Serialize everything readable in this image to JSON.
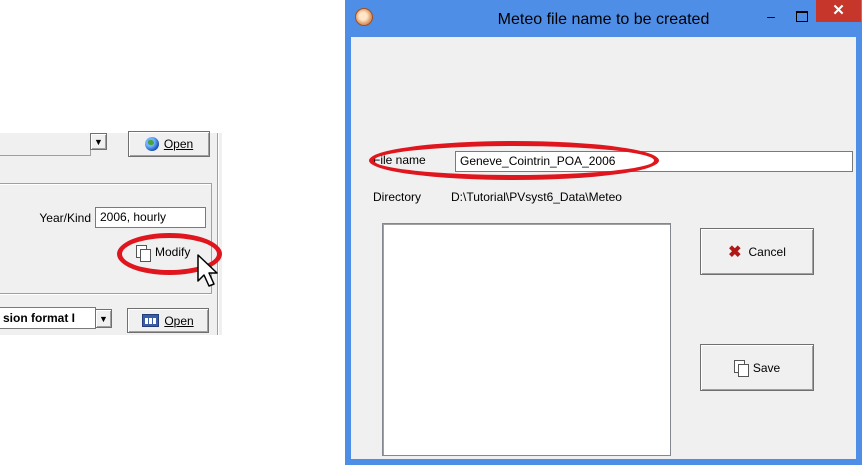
{
  "left_panel": {
    "top_open_label": "Open",
    "year_kind_label": "Year/Kind",
    "year_kind_value": "2006, hourly",
    "modify_label": "Modify",
    "format_select_value": "sion format I",
    "bottom_open_label": "Open"
  },
  "dialog": {
    "title": "Meteo file name to be created",
    "minimize_glyph": "–",
    "close_glyph": "✕",
    "file_name_label": "File name",
    "file_name_value": "Geneve_Cointrin_POA_2006",
    "directory_label": "Directory",
    "directory_value": "D:\\Tutorial\\PVsyst6_Data\\Meteo",
    "cancel_label": "Cancel",
    "save_label": "Save"
  },
  "colors": {
    "titlebar": "#4f8ee6",
    "close_button": "#c7362b",
    "highlight_ellipse": "#e0161e"
  },
  "icons": [
    "globe-icon",
    "table-icon",
    "modify-icon",
    "cancel-x-icon",
    "save-icon",
    "mouse-cursor-icon",
    "app-icon"
  ]
}
